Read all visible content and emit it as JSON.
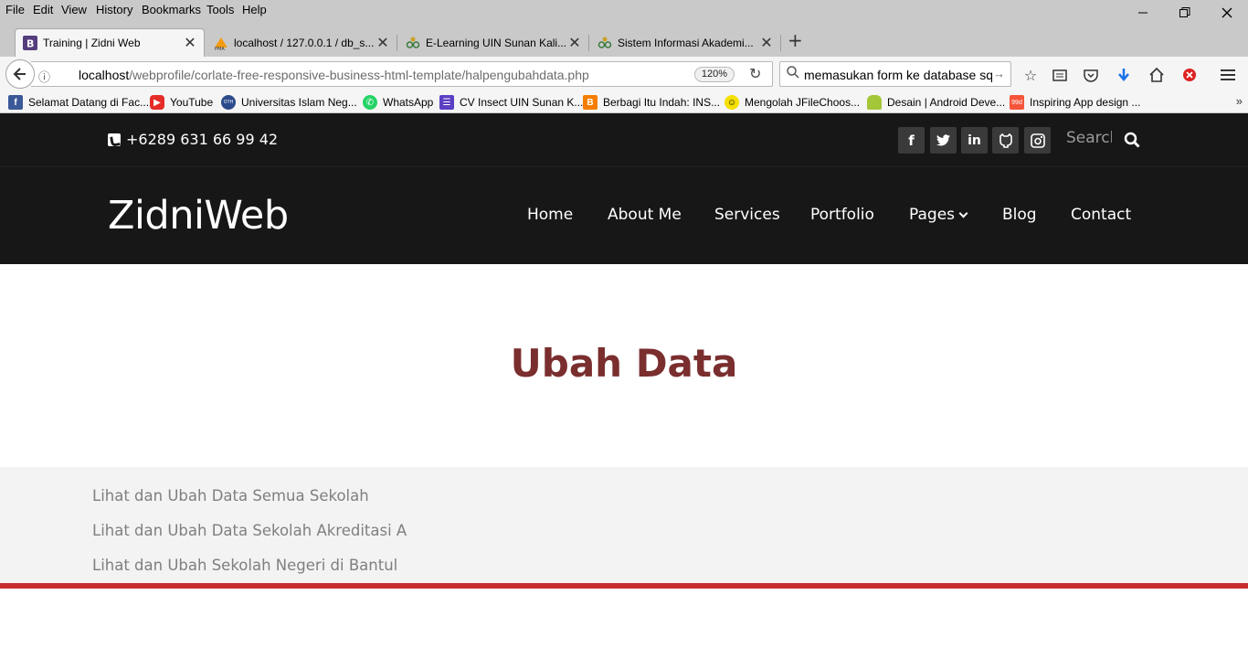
{
  "browser": {
    "menu": [
      "File",
      "Edit",
      "View",
      "History",
      "Bookmarks",
      "Tools",
      "Help"
    ],
    "tabs": [
      {
        "title": "Training | Zidni Web",
        "active": true
      },
      {
        "title": "localhost / 127.0.0.1 / db_s...",
        "active": false
      },
      {
        "title": "E-Learning UIN Sunan Kali...",
        "active": false
      },
      {
        "title": "Sistem Informasi Akademi...",
        "active": false
      }
    ],
    "url_host": "localhost",
    "url_path": "/webprofile/corlate-free-responsive-business-html-template/halpengubahdata.php",
    "zoom": "120%",
    "search_query": "memasukan form ke database sql",
    "bookmarks": [
      "Selamat Datang di Fac...",
      "YouTube",
      "Universitas Islam Neg...",
      "WhatsApp",
      "CV Insect UIN Sunan K...",
      "Berbagi Itu Indah: INS...",
      "Mengolah JFileChoos...",
      "Desain | Android Deve...",
      "Inspiring App design ..."
    ],
    "bookmarks_overflow": "»"
  },
  "site": {
    "phone": "+6289 631 66 99 42",
    "social_icons": [
      "facebook-icon",
      "twitter-icon",
      "linkedin-icon",
      "github-icon",
      "instagram-icon"
    ],
    "search_placeholder": "Search",
    "logo": "ZidniWeb",
    "nav": [
      "Home",
      "About Me",
      "Services",
      "Portfolio",
      "Pages",
      "Blog",
      "Contact"
    ],
    "page_title": "Ubah Data",
    "links": [
      "Lihat dan Ubah Data Semua Sekolah",
      "Lihat dan Ubah Data Sekolah Akreditasi A",
      "Lihat dan Ubah Sekolah Negeri di Bantul"
    ],
    "colors": {
      "dark": "#171717",
      "title": "#7a2e2e",
      "accent_line": "#c82d2d",
      "link": "#7f7f7f"
    }
  }
}
